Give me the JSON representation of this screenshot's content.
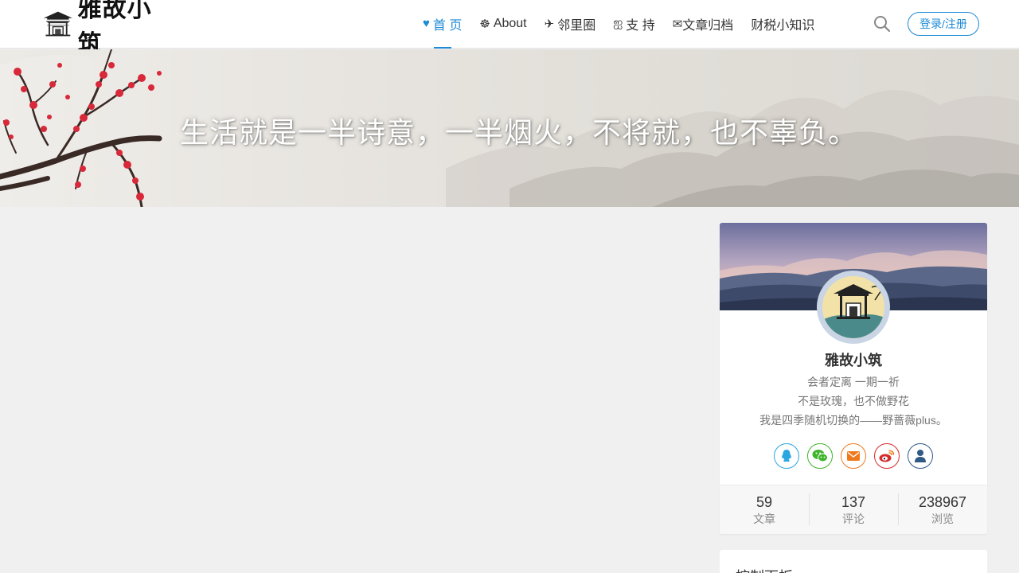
{
  "site": {
    "logo_text": "雅故小筑"
  },
  "nav": {
    "items": [
      {
        "icon": "♥",
        "label": "首 页",
        "active": true
      },
      {
        "icon": "☸",
        "label": "About"
      },
      {
        "icon": "✈",
        "label": "邻里圈"
      },
      {
        "icon": "ஐ",
        "label": "支 持"
      },
      {
        "icon": "✉",
        "label": "文章归档"
      },
      {
        "icon": "",
        "label": "财税小知识"
      }
    ],
    "login_label": "登录/注册"
  },
  "banner": {
    "slogan": "生活就是一半诗意，一半烟火，不将就，也不辜负。"
  },
  "profile": {
    "name": "雅故小筑",
    "motto": [
      "会者定离 一期一祈",
      "不是玫瑰，也不做野花",
      "我是四季随机切换的——野蔷薇plus。"
    ],
    "socials": [
      {
        "name": "qq",
        "color": "#2aa6e0"
      },
      {
        "name": "wechat",
        "color": "#3fb52c"
      },
      {
        "name": "email",
        "color": "#ef7a1e"
      },
      {
        "name": "weibo",
        "color": "#d52b2b"
      },
      {
        "name": "user",
        "color": "#2f5a86"
      }
    ],
    "stats": [
      {
        "value": "59",
        "label": "文章"
      },
      {
        "value": "137",
        "label": "评论"
      },
      {
        "value": "238967",
        "label": "浏览"
      }
    ]
  },
  "panel": {
    "title": "控制面板"
  }
}
